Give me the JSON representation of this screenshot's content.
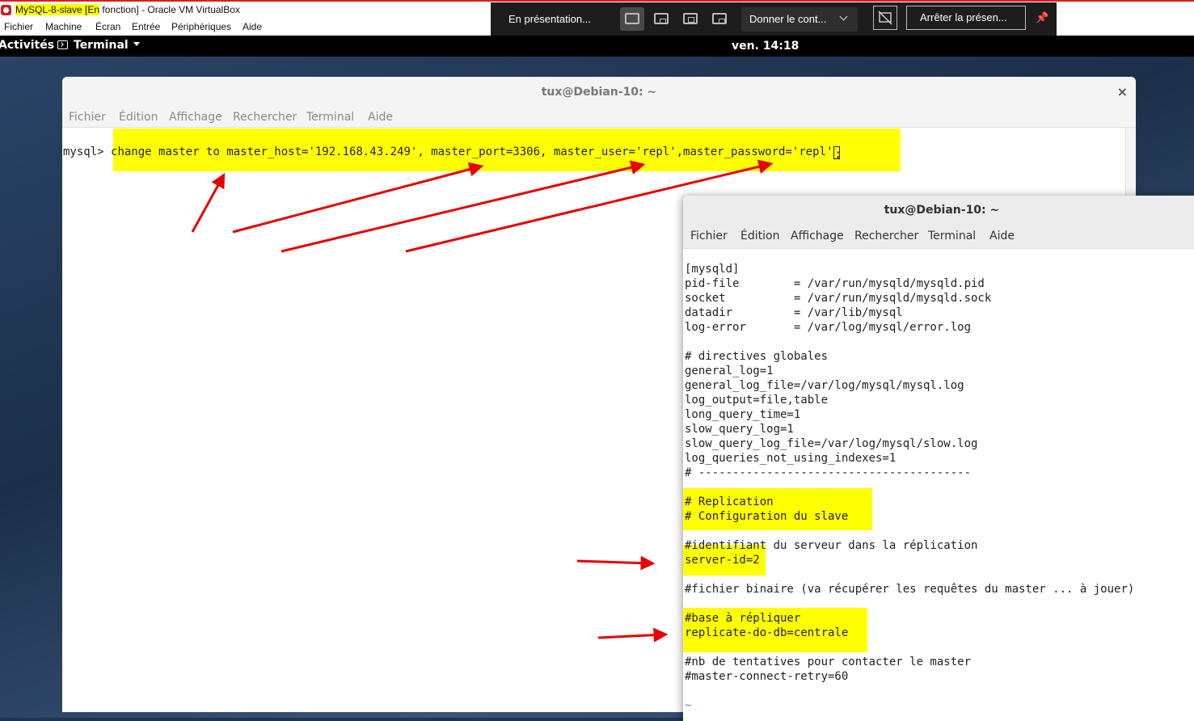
{
  "host": {
    "vbox_title_vm": "MySQL-8-slave [En",
    "vbox_title_rest": " fonction] - Oracle VM VirtualBox",
    "menu": [
      "Fichier",
      "Machine",
      "Écran",
      "Entrée",
      "Périphériques",
      "Aide"
    ]
  },
  "presentation": {
    "status": "En présentation...",
    "give_control": "Donner le cont...",
    "stop": "Arrêter la présen..."
  },
  "gnome": {
    "activities": "Activités",
    "app_name": "Terminal",
    "clock": "ven. 14:18"
  },
  "terminal1": {
    "title": "tux@Debian-10: ~",
    "menu": [
      "Fichier",
      "Édition",
      "Affichage",
      "Rechercher",
      "Terminal",
      "Aide"
    ],
    "prompt": "mysql> ",
    "command": "change master to master_host='192.168.43.249', master_port=3306, master_user='repl',master_password='repl'",
    "command_end": ";"
  },
  "terminal2": {
    "title": "tux@Debian-10: ~",
    "menu": [
      "Fichier",
      "Édition",
      "Affichage",
      "Rechercher",
      "Terminal",
      "Aide"
    ],
    "lines": [
      "[mysqld]",
      "pid-file        = /var/run/mysqld/mysqld.pid",
      "socket          = /var/run/mysqld/mysqld.sock",
      "datadir         = /var/lib/mysql",
      "log-error       = /var/log/mysql/error.log",
      "",
      "# directives globales",
      "general_log=1",
      "general_log_file=/var/log/mysql/mysql.log",
      "log_output=file,table",
      "long_query_time=1",
      "slow_query_log=1",
      "slow_query_log_file=/var/log/mysql/slow.log",
      "log_queries_not_using_indexes=1",
      "# ----------------------------------------",
      "",
      "# Replication",
      "# Configuration du slave",
      "",
      "#identifiant du serveur dans la réplication",
      "server-id=2",
      "",
      "#fichier binaire (va récupérer les requêtes du master ... à jouer)",
      "",
      "#base à répliquer",
      "replicate-do-db=centrale",
      "",
      "#nb de tentatives pour contacter le master",
      "#master-connect-retry=60",
      "",
      "~"
    ]
  },
  "colors": {
    "highlight": "#ffff00",
    "arrow": "#e60000",
    "vbox_accent": "#d61f1f"
  }
}
